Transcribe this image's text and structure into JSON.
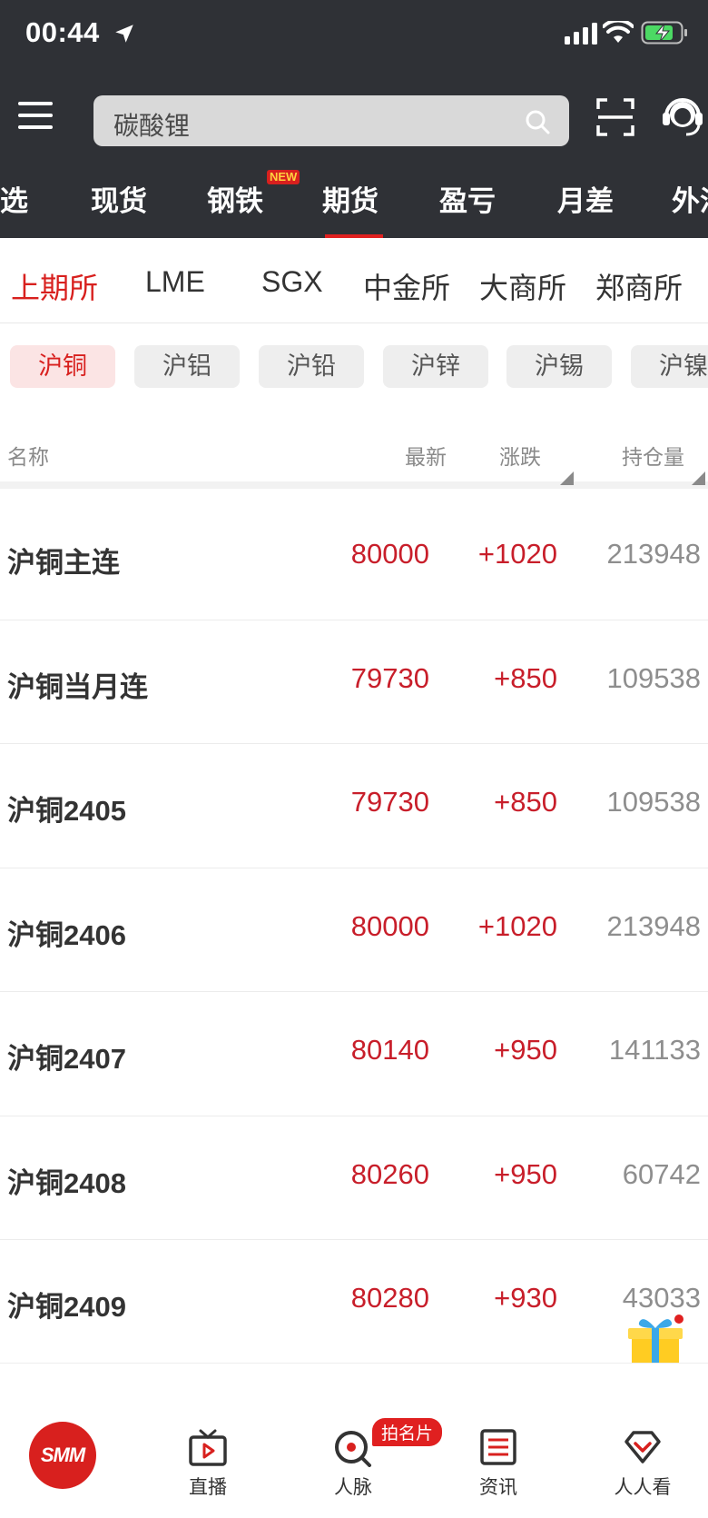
{
  "status_bar": {
    "time": "00:44"
  },
  "search": {
    "placeholder": "碳酸锂"
  },
  "category_tabs": [
    {
      "label": "选",
      "active": false
    },
    {
      "label": "现货",
      "active": false
    },
    {
      "label": "钢铁",
      "active": false,
      "badge": "NEW"
    },
    {
      "label": "期货",
      "active": true
    },
    {
      "label": "盈亏",
      "active": false
    },
    {
      "label": "月差",
      "active": false
    },
    {
      "label": "外汇",
      "active": false
    }
  ],
  "exchange_tabs": [
    {
      "label": "上期所",
      "active": true
    },
    {
      "label": "LME",
      "active": false
    },
    {
      "label": "SGX",
      "active": false
    },
    {
      "label": "中金所",
      "active": false
    },
    {
      "label": "大商所",
      "active": false
    },
    {
      "label": "郑商所",
      "active": false
    }
  ],
  "product_chips": [
    {
      "label": "沪铜",
      "active": true
    },
    {
      "label": "沪铝",
      "active": false
    },
    {
      "label": "沪铅",
      "active": false
    },
    {
      "label": "沪锌",
      "active": false
    },
    {
      "label": "沪锡",
      "active": false
    },
    {
      "label": "沪镍",
      "active": false
    }
  ],
  "columns": {
    "name": "名称",
    "latest": "最新",
    "change": "涨跌",
    "open_interest": "持仓量"
  },
  "rows": [
    {
      "name": "沪铜主连",
      "latest": "80000",
      "change": "+1020",
      "open_interest": "213948"
    },
    {
      "name": "沪铜当月连",
      "latest": "79730",
      "change": "+850",
      "open_interest": "109538"
    },
    {
      "name": "沪铜2405",
      "latest": "79730",
      "change": "+850",
      "open_interest": "109538"
    },
    {
      "name": "沪铜2406",
      "latest": "80000",
      "change": "+1020",
      "open_interest": "213948"
    },
    {
      "name": "沪铜2407",
      "latest": "80140",
      "change": "+950",
      "open_interest": "141133"
    },
    {
      "name": "沪铜2408",
      "latest": "80260",
      "change": "+950",
      "open_interest": "60742"
    },
    {
      "name": "沪铜2409",
      "latest": "80280",
      "change": "+930",
      "open_interest": "43033"
    }
  ],
  "bottom_nav": {
    "logo": "SMM",
    "items": [
      {
        "label": "直播",
        "icon": "tv-play-icon"
      },
      {
        "label": "人脉",
        "icon": "contacts-icon",
        "badge": "拍名片"
      },
      {
        "label": "资讯",
        "icon": "news-icon"
      },
      {
        "label": "人人看",
        "icon": "diamond-heart-icon"
      }
    ]
  },
  "colors": {
    "header_bg": "#2f3136",
    "accent_red": "#d8201e",
    "up_red": "#c81e2a"
  }
}
